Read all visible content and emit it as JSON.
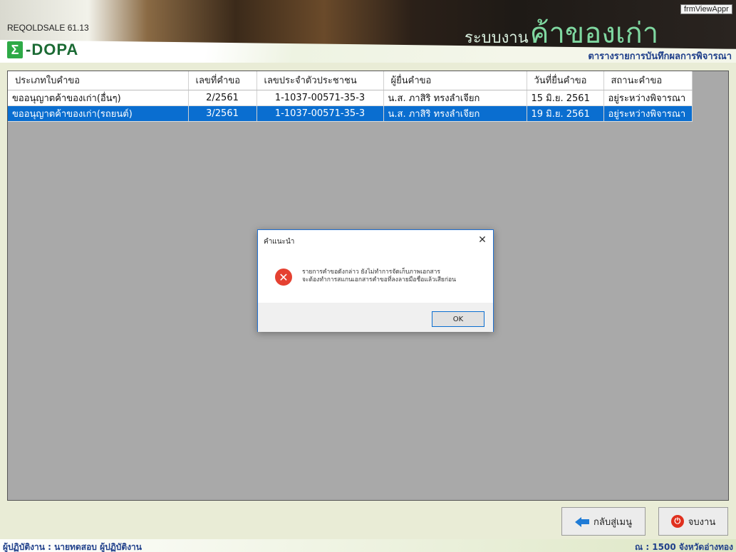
{
  "header": {
    "app_version": "REQOLDSALE 61.13",
    "logo_mark": "Σ",
    "logo_text": "-DOPA",
    "system_prefix": "ระบบงาน",
    "system_name": "ค้าของเก่า",
    "form_name": "frmViewAppr",
    "page_subtitle": "ตารางรายการบันทึกผลการพิจารณา"
  },
  "grid": {
    "columns": [
      "ประเภทใบคำขอ",
      "เลขที่คำขอ",
      "เลขประจำตัวประชาชน",
      "ผู้ยื่นคำขอ",
      "วันที่ยื่นคำขอ",
      "สถานะคำขอ"
    ],
    "rows": [
      [
        "ขออนุญาตค้าของเก่า(อื่นๆ)",
        "2/2561",
        "1-1037-00571-35-3",
        "น.ส. ภาสิริ ทรงลำเจียก",
        "15 มิ.ย. 2561",
        "อยู่ระหว่างพิจารณา"
      ],
      [
        "ขออนุญาตค้าของเก่า(รถยนต์)",
        "3/2561",
        "1-1037-00571-35-3",
        "น.ส. ภาสิริ ทรงลำเจียก",
        "19 มิ.ย. 2561",
        "อยู่ระหว่างพิจารณา"
      ]
    ],
    "selected_row": 1
  },
  "dialog": {
    "title": "คำแนะนำ",
    "close_glyph": "✕",
    "error_glyph": "✕",
    "message_line1": "รายการคำขอดังกล่าว ยังไม่ทำการจัดเก็บภาพเอกสาร",
    "message_line2": "จะต้องทำการสแกนเอกสารคำขอที่ลงลายมือชื่อแล้วเสียก่อน",
    "ok_label": "OK"
  },
  "buttons": {
    "back_label": "กลับสู่เมนู",
    "exit_label": "จบงาน",
    "exit_glyph": "⏻"
  },
  "status": {
    "left": "ผู้ปฏิบัติงาน : นายทดสอบ ผู้ปฏิบัติงาน",
    "right": "ณ : 1500 จังหวัดอ่างทอง"
  }
}
